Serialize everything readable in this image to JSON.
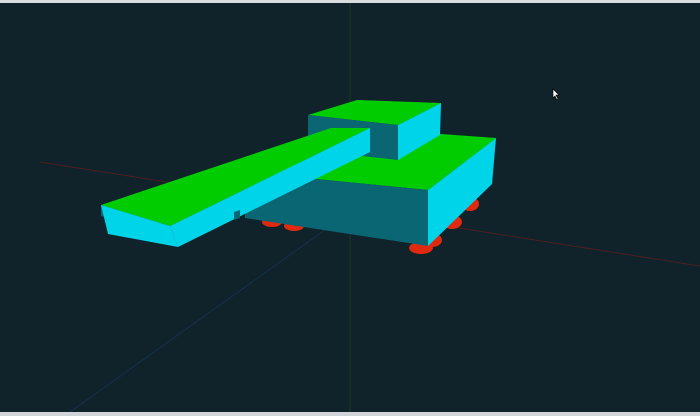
{
  "viewport": {
    "background": "#11232a"
  },
  "scene": {
    "object": "tank",
    "axes": {
      "x_color": "#4a1e24",
      "y_color": "#163a2a",
      "z_color": "#16304a"
    },
    "colors": {
      "top_face": "#00cc00",
      "front_face": "#00d4e8",
      "side_face": "#0a6672",
      "wheels": "#e02a10"
    }
  },
  "cursor": {
    "icon": "arrow-cursor-icon"
  }
}
